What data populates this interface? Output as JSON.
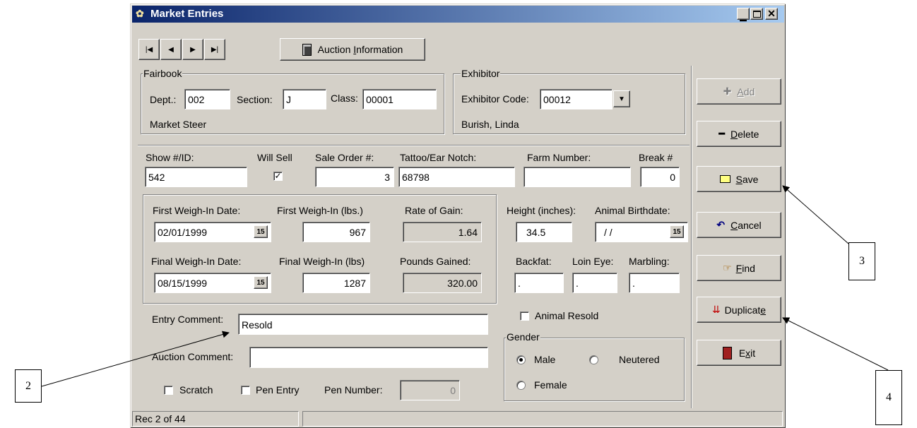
{
  "window": {
    "title": "Market Entries"
  },
  "toolbar": {
    "first": "first",
    "prev": "prev",
    "next": "next",
    "last": "last",
    "auction_pre": "Auction ",
    "auction_ul": "I",
    "auction_post": "nformation"
  },
  "fairbook": {
    "legend": "Fairbook",
    "dept_label": "Dept.:",
    "dept_value": "002",
    "section_label": "Section:",
    "section_value": "J",
    "class_label": "Class:",
    "class_value": "00001",
    "description": "Market Steer"
  },
  "exhibitor": {
    "legend": "Exhibitor",
    "code_label": "Exhibitor Code:",
    "code_value": "00012",
    "name": "Burish, Linda"
  },
  "entry": {
    "show_id_label": "Show #/ID:",
    "show_id_value": "542",
    "will_sell_label": "Will Sell",
    "will_sell_checked": true,
    "sale_order_label": "Sale Order #:",
    "sale_order_value": "3",
    "tattoo_label": "Tattoo/Ear Notch:",
    "tattoo_value": "68798",
    "farm_label": "Farm Number:",
    "farm_value": "",
    "break_label": "Break #",
    "break_value": "0"
  },
  "weights": {
    "first_date_label": "First Weigh-In Date:",
    "first_date_value": "02/01/1999",
    "first_weight_label": "First Weigh-In (lbs.)",
    "first_weight_value": "967",
    "rate_label": "Rate of Gain:",
    "rate_value": "1.64",
    "final_date_label": "Final Weigh-In Date:",
    "final_date_value": "08/15/1999",
    "final_weight_label": "Final Weigh-In (lbs)",
    "final_weight_value": "1287",
    "gained_label": "Pounds Gained:",
    "gained_value": "320.00",
    "cal_icon": "15"
  },
  "measures": {
    "height_label": "Height (inches):",
    "height_value": "34.5",
    "birth_label": "Animal Birthdate:",
    "birth_value": " / /",
    "backfat_label": "Backfat:",
    "backfat_value": ".",
    "loin_label": "Loin Eye:",
    "loin_value": ".",
    "marbling_label": "Marbling:",
    "marbling_value": "."
  },
  "comments": {
    "entry_label": "Entry Comment:",
    "entry_value": "Resold",
    "auction_label": "Auction Comment:",
    "auction_value": ""
  },
  "flags": {
    "resold_label": "Animal Resold",
    "scratch_label": "Scratch",
    "pen_entry_label": "Pen Entry",
    "pen_number_label": "Pen Number:",
    "pen_number_value": "0"
  },
  "gender": {
    "legend": "Gender",
    "male": "Male",
    "neutered": "Neutered",
    "female": "Female",
    "selected": "Male"
  },
  "actions": {
    "add_ul": "A",
    "add_rest": "dd",
    "delete_ul": "D",
    "delete_rest": "elete",
    "save_ul": "S",
    "save_rest": "ave",
    "cancel_ul": "C",
    "cancel_rest": "ancel",
    "find_ul": "F",
    "find_rest": "ind",
    "dup_pre": "Duplicat",
    "dup_ul": "e",
    "exit_pre": "E",
    "exit_ul": "x",
    "exit_rest": "it"
  },
  "status": {
    "record": "Rec 2 of 44"
  },
  "callouts": {
    "c2": "2",
    "c3": "3",
    "c4": "4"
  },
  "colors": {
    "title_start": "#0a246a",
    "title_end": "#a6caf0",
    "face": "#d4d0c8"
  }
}
